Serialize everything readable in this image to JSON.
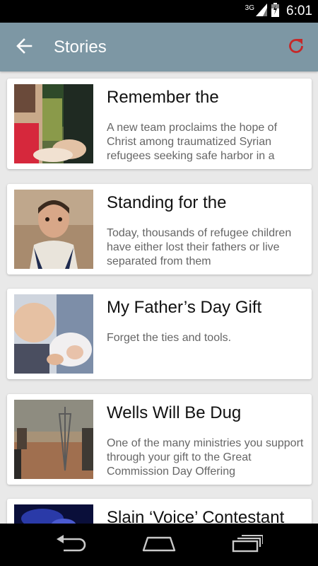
{
  "status_bar": {
    "network": "3G",
    "time": "6:01"
  },
  "app_bar": {
    "title": "Stories",
    "back_icon": "arrow-back-icon",
    "refresh_icon": "refresh-icon",
    "refresh_color": "#c62828"
  },
  "stories": [
    {
      "title": "Remember the",
      "summary": "A new team proclaims the hope of Christ among traumatized Syrian refugees seeking safe harbor in a",
      "image": "child-hospital-photo"
    },
    {
      "title": "Standing for the",
      "summary": "Today, thousands of refugee children have either lost their fathers or live separated from them",
      "image": "boy-portrait-photo"
    },
    {
      "title": "My Father’s Day Gift",
      "summary": "Forget the ties and tools.",
      "image": "father-baby-photo"
    },
    {
      "title": "Wells Will Be Dug",
      "summary": "One of the many ministries you support through your gift to the Great Commission Day Offering",
      "image": "water-well-photo"
    },
    {
      "title": "Slain ‘Voice’ Contestant",
      "summary": "",
      "image": "concert-stage-photo"
    }
  ],
  "nav_bar": {
    "back": "nav-back-icon",
    "home": "nav-home-icon",
    "recents": "nav-recents-icon"
  }
}
